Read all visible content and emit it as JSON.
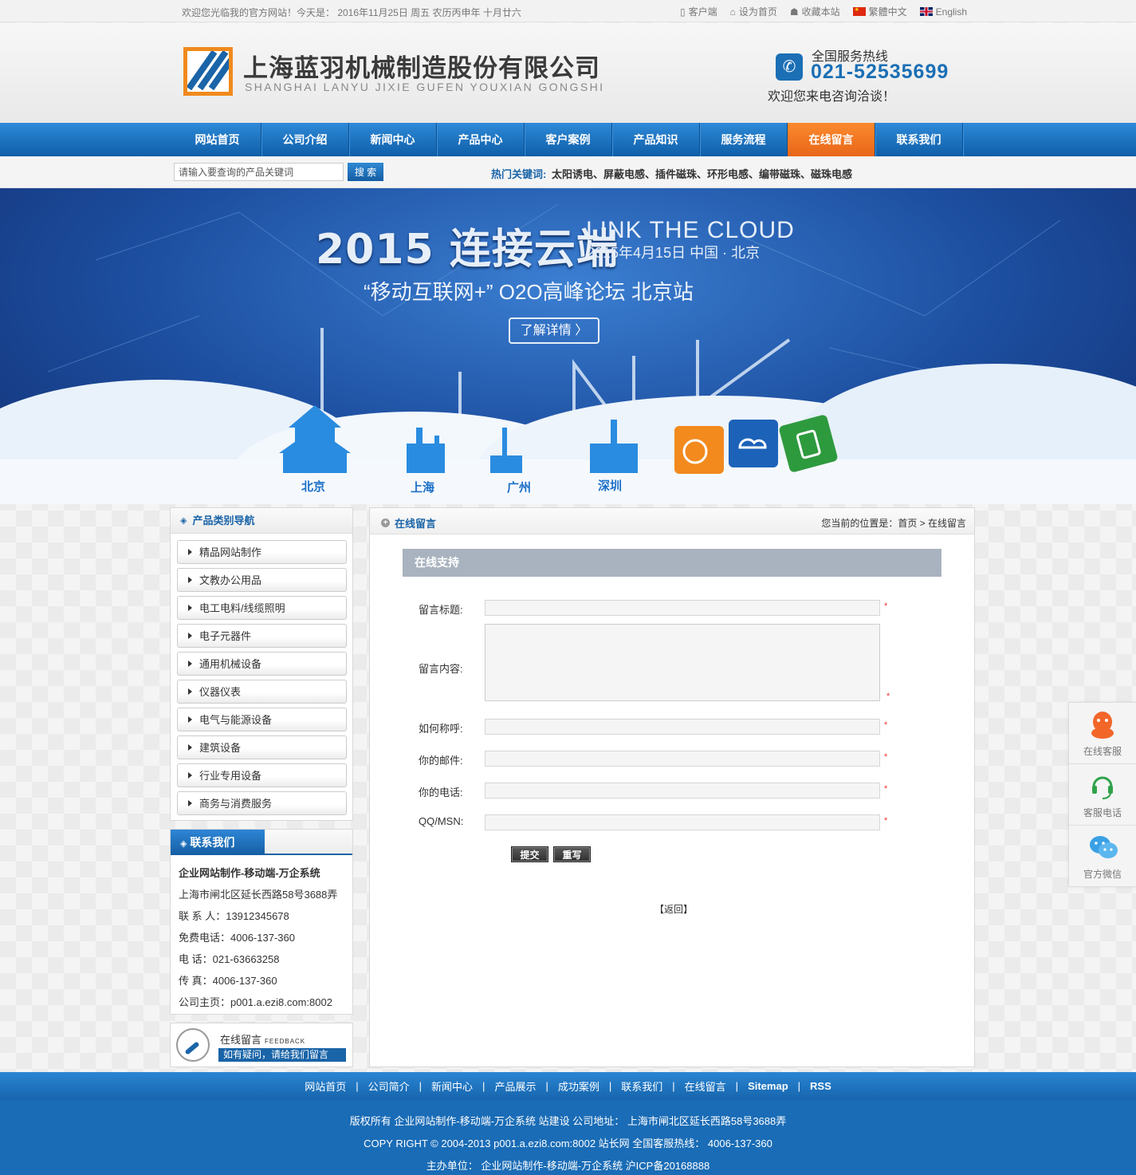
{
  "topbar": {
    "welcome": "欢迎您光临我的官方网站！今天是：  2016年11月25日 周五 农历丙申年 十月廿六",
    "links": [
      "客户端",
      "设为首页",
      "收藏本站",
      "繁體中文",
      "English"
    ]
  },
  "header": {
    "company_cn": "上海蓝羽机械制造股份有限公司",
    "company_en": "SHANGHAI LANYU JIXIE GUFEN YOUXIAN GONGSHI",
    "hotline_label": "全国服务热线",
    "hotline_number": "021-52535699",
    "hotline_tip": "欢迎您来电咨询洽谈！"
  },
  "nav": {
    "items": [
      "网站首页",
      "公司介绍",
      "新闻中心",
      "产品中心",
      "客户案例",
      "产品知识",
      "服务流程",
      "在线留言",
      "联系我们"
    ],
    "active": "在线留言",
    "active_color": "#f07a22"
  },
  "search": {
    "input_value": "请输入要查询的产品关键词",
    "button": "搜 索",
    "hot_label": "热门关键词:",
    "hot_words": "太阳诱电、屏蔽电感、插件磁珠、环形电感、编带磁珠、磁珠电感"
  },
  "banner": {
    "title": "2015 连接云端",
    "title_en": "LINK THE CLOUD",
    "date": "2015年4月15日 中国 · 北京",
    "subtitle": "“移动互联网+” O2O高峰论坛 北京站",
    "button": "了解详情 〉",
    "cities": [
      "北京",
      "上海",
      "广州",
      "深圳"
    ]
  },
  "sidebar": {
    "category_title": "产品类别导航",
    "categories": [
      "精品网站制作",
      "文教办公用品",
      "电工电料/线缆照明",
      "电子元器件",
      "通用机械设备",
      "仪器仪表",
      "电气与能源设备",
      "建筑设备",
      "行业专用设备",
      "商务与消费服务"
    ],
    "contact_title": "联系我们",
    "contact_company": "企业网站制作-移动端-万企系统",
    "contact_lines": [
      "上海市闸北区延长西路58号3688弄",
      "联 系 人：13912345678",
      "免费电话：4006-137-360",
      "电 话：021-63663258",
      "传 真：4006-137-360",
      "公司主页：p001.a.ezi8.com:8002"
    ],
    "feedback_title": "在线留言",
    "feedback_sub": "FEEDBACK",
    "feedback_bar": "如有疑问，请给我们留言"
  },
  "main": {
    "title": "在线留言",
    "breadcrumb": "您当前的位置是：首页 > 在线留言",
    "support_bar": "在线支持",
    "fields": {
      "title_label": "留言标题:",
      "content_label": "留言内容:",
      "name_label": "如何称呼:",
      "email_label": "你的邮件:",
      "phone_label": "你的电话:",
      "qq_label": "QQ/MSN:"
    },
    "required_mark": "*",
    "submit": "提交",
    "reset": "重写",
    "back": "【返回】"
  },
  "float": {
    "items": [
      "在线客服",
      "客服电话",
      "官方微信"
    ]
  },
  "footer": {
    "links": [
      "网站首页",
      "公司简介",
      "新闻中心",
      "产品展示",
      "成功案例",
      "联系我们",
      "在线留言",
      "Sitemap",
      "RSS"
    ],
    "separator": "|",
    "line1": "版权所有 企业网站制作-移动端-万企系统 站建设 公司地址： 上海市闸北区延长西路58号3688弄",
    "line2": "COPY RIGHT © 2004-2013 p001.a.ezi8.com:8002 站长网 全国客服热线： 4006-137-360",
    "line3": "主办单位： 企业网站制作-移动端-万企系统 沪ICP备20168888"
  }
}
